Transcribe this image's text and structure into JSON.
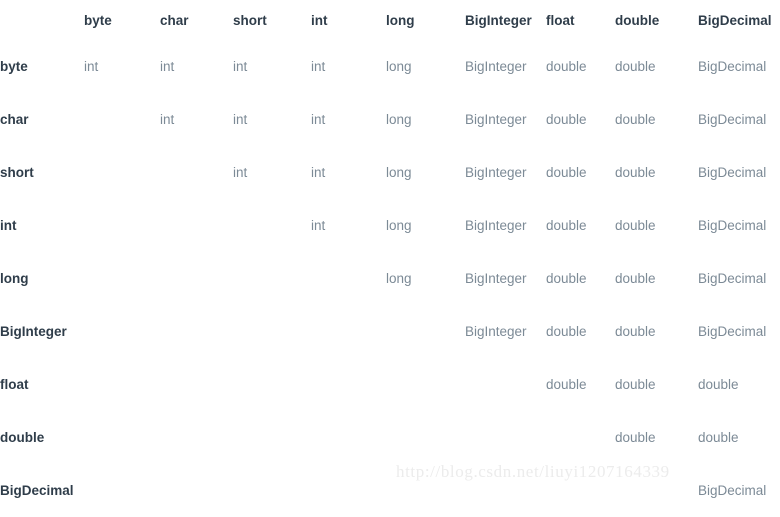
{
  "table": {
    "corner_label": "",
    "columns": [
      "byte",
      "char",
      "short",
      "int",
      "long",
      "BigInteger",
      "float",
      "double",
      "BigDecimal"
    ],
    "rows": [
      {
        "header": "byte",
        "cells": [
          "int",
          "int",
          "int",
          "int",
          "long",
          "BigInteger",
          "double",
          "double",
          "BigDecimal"
        ]
      },
      {
        "header": "char",
        "cells": [
          "",
          "int",
          "int",
          "int",
          "long",
          "BigInteger",
          "double",
          "double",
          "BigDecimal"
        ]
      },
      {
        "header": "short",
        "cells": [
          "",
          "",
          "int",
          "int",
          "long",
          "BigInteger",
          "double",
          "double",
          "BigDecimal"
        ]
      },
      {
        "header": "int",
        "cells": [
          "",
          "",
          "",
          "int",
          "long",
          "BigInteger",
          "double",
          "double",
          "BigDecimal"
        ]
      },
      {
        "header": "long",
        "cells": [
          "",
          "",
          "",
          "",
          "long",
          "BigInteger",
          "double",
          "double",
          "BigDecimal"
        ]
      },
      {
        "header": "BigInteger",
        "cells": [
          "",
          "",
          "",
          "",
          "",
          "BigInteger",
          "double",
          "double",
          "BigDecimal"
        ]
      },
      {
        "header": "float",
        "cells": [
          "",
          "",
          "",
          "",
          "",
          "",
          "double",
          "double",
          "double"
        ]
      },
      {
        "header": "double",
        "cells": [
          "",
          "",
          "",
          "",
          "",
          "",
          "",
          "double",
          "double"
        ]
      },
      {
        "header": "BigDecimal",
        "cells": [
          "",
          "",
          "",
          "",
          "",
          "",
          "",
          "",
          "BigDecimal"
        ]
      }
    ]
  },
  "watermark": {
    "text": "http://blog.csdn.net/liuyi1207164339"
  },
  "colors": {
    "background": "#ffffff",
    "header_text": "#2f3d4a",
    "cell_text": "#7c8a96",
    "watermark_text": "#ececec"
  }
}
